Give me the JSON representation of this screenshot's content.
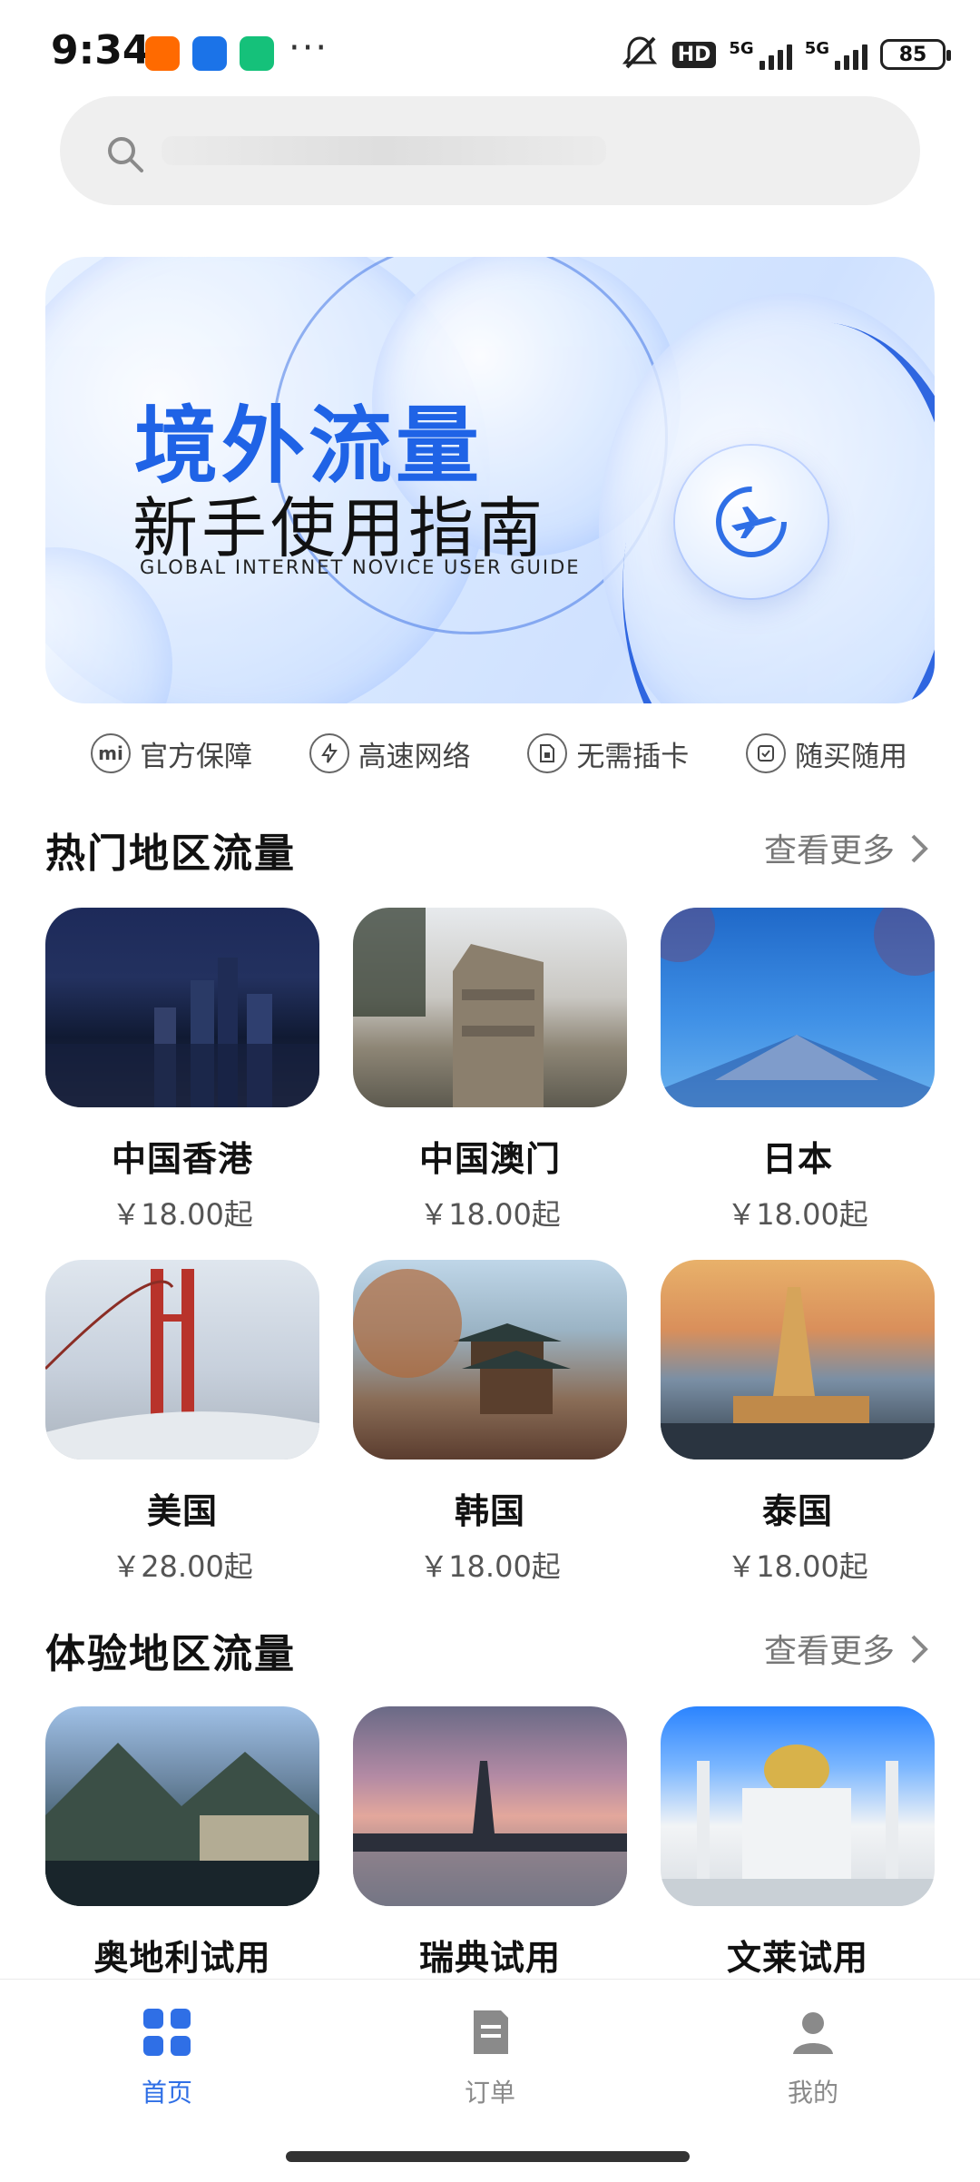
{
  "status_bar": {
    "time": "9:34",
    "icons": [
      "taobao-app-icon",
      "mi-remote-icon",
      "mi-home-icon"
    ],
    "more": "···",
    "hd_label": "HD",
    "signal1_label": "5G",
    "signal2_label": "5G",
    "battery": "85"
  },
  "search": {
    "placeholder": ""
  },
  "banner": {
    "title": "境外流量",
    "subtitle": "新手使用指南",
    "en_text": "GLOBAL INTERNET NOVICE USER GUIDE",
    "accent": "#1f63e6"
  },
  "guarantees": [
    {
      "icon": "mi-logo-icon",
      "label": "官方保障"
    },
    {
      "icon": "lightning-icon",
      "label": "高速网络"
    },
    {
      "icon": "sim-card-icon",
      "label": "无需插卡"
    },
    {
      "icon": "checkbox-icon",
      "label": "随买随用"
    }
  ],
  "hot_section": {
    "title": "热门地区流量",
    "more": "查看更多",
    "items": [
      {
        "name": "中国香港",
        "price": "￥18.00起",
        "photo": "hong-kong-city-night"
      },
      {
        "name": "中国澳门",
        "price": "￥18.00起",
        "photo": "macau-ruins"
      },
      {
        "name": "日本",
        "price": "￥18.00起",
        "photo": "mount-fuji"
      },
      {
        "name": "美国",
        "price": "￥28.00起",
        "photo": "golden-gate-bridge"
      },
      {
        "name": "韩国",
        "price": "￥18.00起",
        "photo": "korean-pagoda"
      },
      {
        "name": "泰国",
        "price": "￥18.00起",
        "photo": "thai-temple"
      }
    ]
  },
  "trial_section": {
    "title": "体验地区流量",
    "more": "查看更多",
    "items": [
      {
        "name": "奥地利试用",
        "photo": "hallstatt-lake-village"
      },
      {
        "name": "瑞典试用",
        "photo": "stockholm-sunset"
      },
      {
        "name": "文莱试用",
        "photo": "brunei-mosque"
      }
    ]
  },
  "bottom_nav": {
    "tabs": [
      {
        "label": "首页",
        "icon": "home-grid-icon",
        "active": true
      },
      {
        "label": "订单",
        "icon": "order-document-icon",
        "active": false
      },
      {
        "label": "我的",
        "icon": "profile-icon",
        "active": false
      }
    ],
    "active_color": "#2f6fe6"
  }
}
